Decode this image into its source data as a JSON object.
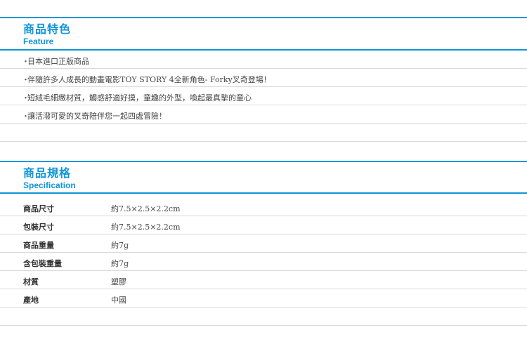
{
  "feature": {
    "title": "商品特色",
    "subtitle": "Feature",
    "bullet_glyph": "・",
    "items": [
      "日本進口正版商品",
      "伴隨許多人成長的動畫電影TOY STORY 4全新角色- Forky叉奇登場！",
      "短絨毛細緻材質，觸感舒適好摸，童趣的外型，喚起最真摯的童心",
      "讓活潑可愛的叉奇陪伴您一起四處冒險！"
    ]
  },
  "spec": {
    "title": "商品規格",
    "subtitle": "Specification",
    "rows": [
      {
        "label": "商品尺寸",
        "value": "約7.5×2.5×2.2cm"
      },
      {
        "label": "包裝尺寸",
        "value": "約7.5×2.5×2.2cm"
      },
      {
        "label": "商品重量",
        "value": "約7g"
      },
      {
        "label": "含包裝重量",
        "value": "約7g"
      },
      {
        "label": "材質",
        "value": "塑膠"
      },
      {
        "label": "產地",
        "value": "中國"
      }
    ]
  },
  "colors": {
    "accent": "#0f95d8",
    "divider": "#d9d9d9"
  }
}
